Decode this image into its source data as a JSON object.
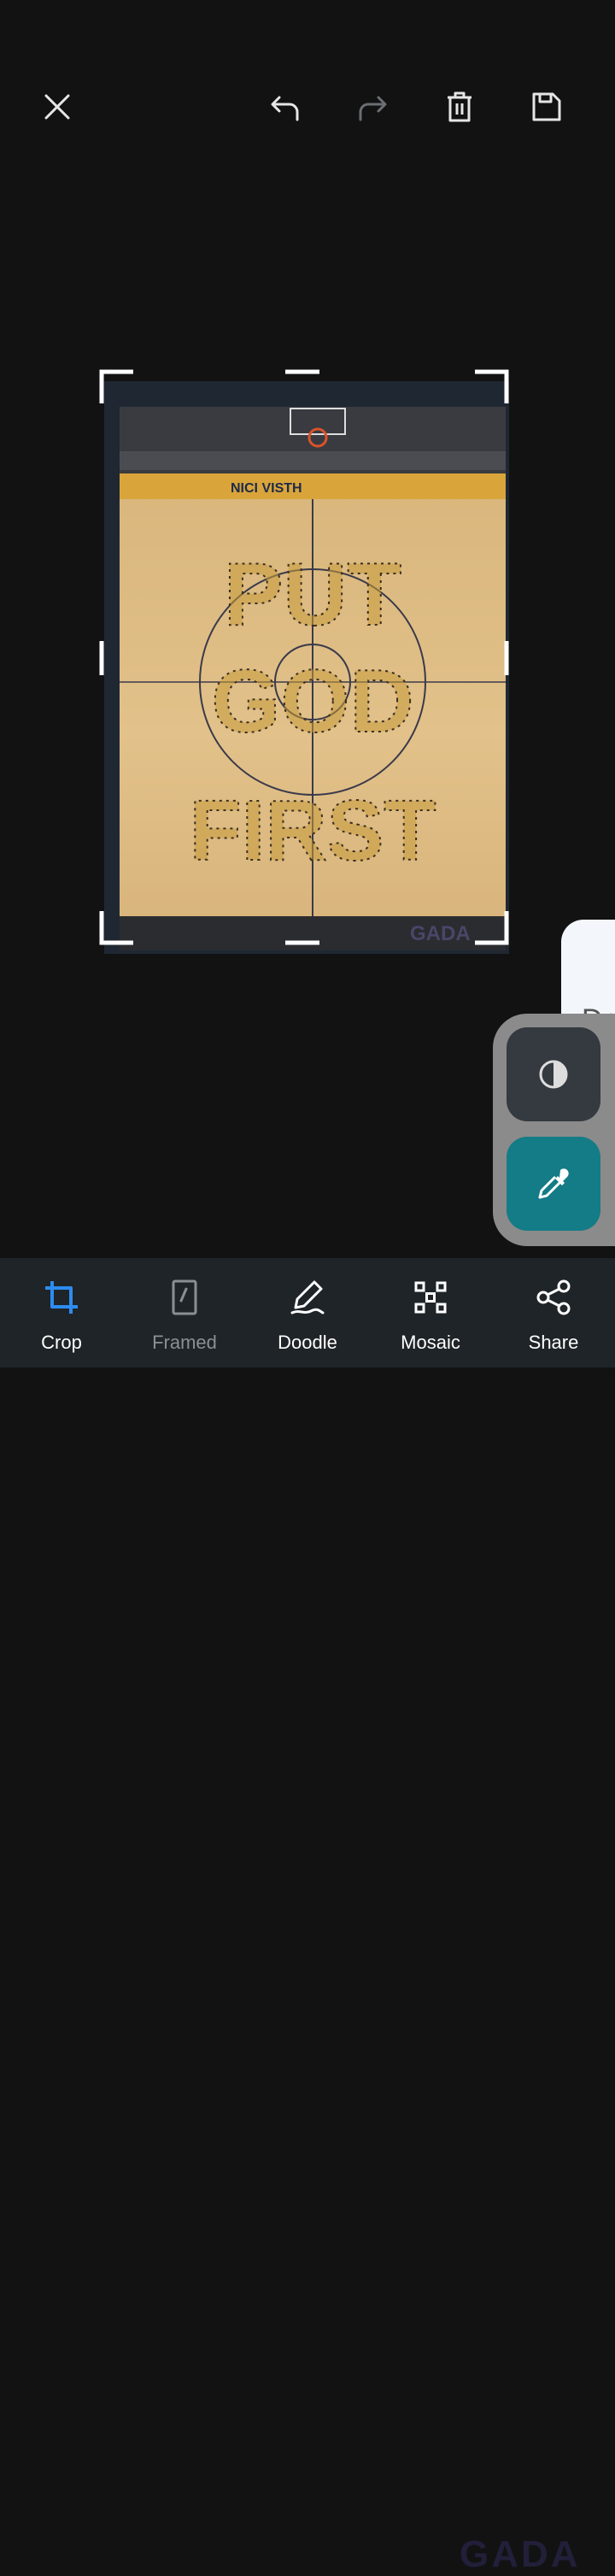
{
  "topbar": {
    "close_icon": "close-icon",
    "undo_icon": "undo-icon",
    "redo_icon": "redo-icon",
    "delete_icon": "trash-icon",
    "save_icon": "save-icon"
  },
  "image": {
    "description_icon": "basketball-court-photo",
    "scoreboard_text": "NICI VISTH",
    "formation_lines": [
      "PUT",
      "GOD",
      "FIRST"
    ],
    "watermark": "GADA"
  },
  "side_card": {
    "text": "Dre"
  },
  "float_panel": {
    "contrast_icon": "contrast-icon",
    "picker_icon": "eyedropper-icon"
  },
  "toolbar": {
    "items": [
      {
        "label": "Crop",
        "icon": "crop-icon",
        "active": true
      },
      {
        "label": "Framed",
        "icon": "frame-icon",
        "disabled": true
      },
      {
        "label": "Doodle",
        "icon": "doodle-icon"
      },
      {
        "label": "Mosaic",
        "icon": "mosaic-icon"
      },
      {
        "label": "Share",
        "icon": "share-icon"
      }
    ],
    "watermark": "GADA"
  },
  "colors": {
    "background": "#121212",
    "accent": "#2d8cf0",
    "toolbar_bg": "#1f2428",
    "picker_bg": "#137c86"
  }
}
